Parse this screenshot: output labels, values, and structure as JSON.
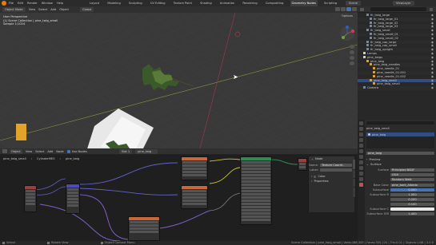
{
  "topbar": {
    "menu": [
      "File",
      "Edit",
      "Render",
      "Window",
      "Help"
    ],
    "workspaces": [
      "Layout",
      "Modeling",
      "Sculpting",
      "UV Editing",
      "Texture Paint",
      "Shading",
      "Animation",
      "Rendering",
      "Compositing",
      "Geometry Nodes",
      "Scripting"
    ],
    "active_workspace": "Geometry Nodes",
    "scene": "Scene",
    "view_layer": "ViewLayer"
  },
  "viewport": {
    "header": [
      "Object Mode",
      "View",
      "Select",
      "Add",
      "Object"
    ],
    "transform": "Global",
    "info_line1": "User Perspective",
    "info_line2": "(1) Scene Collection | pine_twig_small",
    "info_line3": "Sample 1/1024",
    "options": "Options"
  },
  "outliner": {
    "items": [
      "fir_twig_large",
      "fir_twig_large_01",
      "fir_twig_large_02",
      "fir_twig_large_03",
      "fir_twig_small",
      "fir_twig_small_01",
      "fir_twig_small_02",
      "fir_twig_cap_large",
      "fir_twig_cap_small",
      "fir_twig_upright",
      "Lamps",
      "pine_twigs",
      "pine_twig",
      "pine_twig_needles",
      "pine_needle_01",
      "pine_needle_01.001",
      "pine_needle_01.002",
      "pine_twig_small",
      "pine_twig_small",
      "Camera"
    ]
  },
  "node_editor": {
    "header": [
      "Object",
      "View",
      "Select",
      "Add",
      "Node",
      "Use Nodes"
    ],
    "slot": "Slot 1",
    "material": "pine_twig",
    "breadcrumb": [
      "pine_twig_small",
      "CylinderMES",
      "pine_twig"
    ]
  },
  "npanel": {
    "title": "Node",
    "name_label": "Name:",
    "name_value": "Texture Coordi..",
    "label_label": "Label:",
    "color_label": "Color",
    "properties_label": "Properties",
    "tabs": [
      "Node",
      "Tool",
      "View",
      "Options"
    ]
  },
  "properties": {
    "object_name": "pine_twig_small",
    "material_name": "pine_twig",
    "section_preview": "Preview",
    "section_surface": "Surface",
    "surface_label": "Surface",
    "surface_value": "Principled BSDF",
    "distribution": "GGX",
    "subsurface_method": "Random Walk",
    "base_color_label": "Base Color",
    "base_color_value": "pine_bark_Albedo",
    "subsurface_label": "Subsurface",
    "subsurface_value": "0.000",
    "subsurface_radius_label": "Subsurface R",
    "subsurface_radius_values": [
      "1.000",
      "0.200",
      "0.100"
    ],
    "subsurface_color_label": "Subsurface C",
    "subsurface_ior_label": "Subsurface IOR",
    "subsurface_ior_value": "1.400"
  },
  "status": {
    "left": "Select",
    "middle": "Rotate View",
    "right_hint": "Object Context Menu",
    "stats": "Scene Collection | pine_twig_small | Verts:188,345 | Faces:355,220 | Tris:0.01 | Objects:1/46 | 3.0.0"
  },
  "colors": {
    "accent": "#e3a32a",
    "outliner_bg": "#282828",
    "viewport_bg": "#393939",
    "node_bg": "#1f1f1f",
    "wire_purple": "#7f5fc9",
    "wire_yellow": "#c7c729",
    "wire_blue": "#6363c7",
    "node_texture": "#c8683a",
    "node_shader": "#2f8a54",
    "node_vector": "#4b4bb8"
  }
}
